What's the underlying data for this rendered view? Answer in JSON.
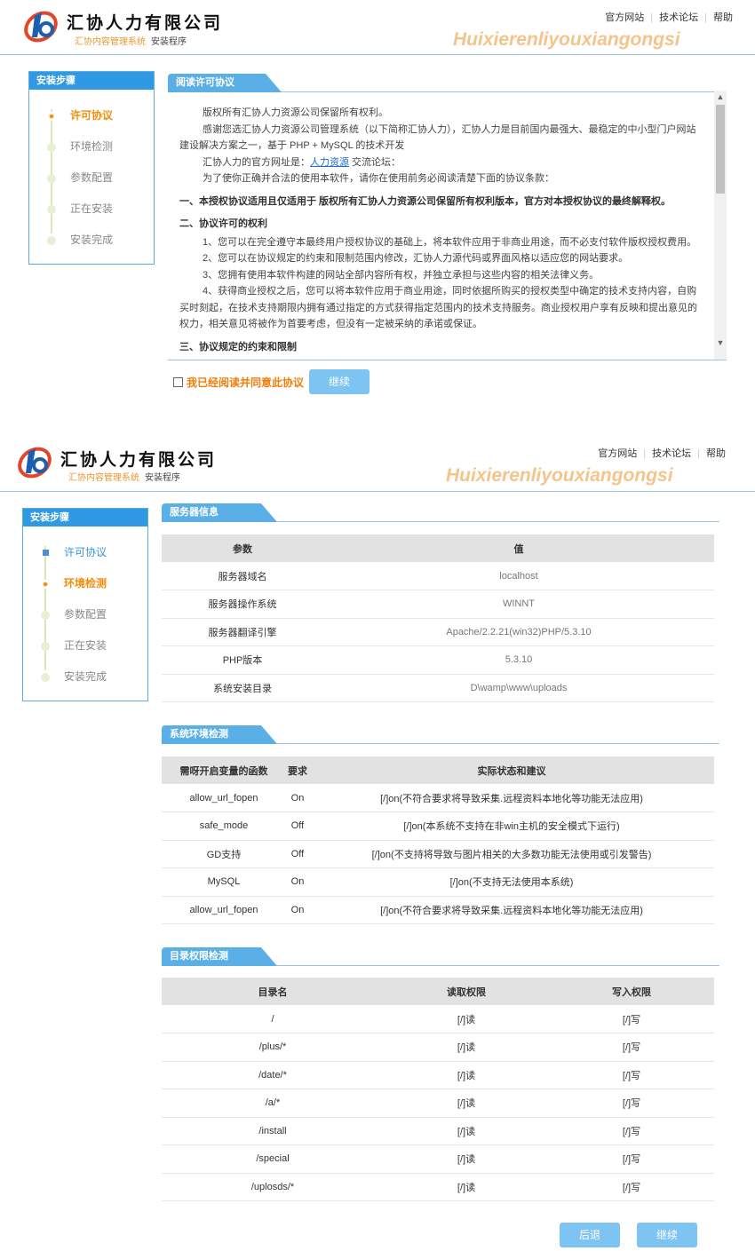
{
  "header": {
    "brand_name": "汇协人力有限公司",
    "brand_system": "汇协内容管理系统",
    "brand_setup": "安装程序",
    "watermark": "Huixierenliyouxiangongsi",
    "nav": [
      "官方网站",
      "技术论坛",
      "帮助"
    ]
  },
  "sidebar": {
    "title": "安装步骤",
    "steps": [
      "许可协议",
      "环境检测",
      "参数配置",
      "正在安装",
      "安装完成"
    ]
  },
  "screen1": {
    "section_title": "阅读许可协议",
    "agreement": {
      "p1": "版权所有汇协人力资源公司保留所有权利。",
      "p2": "感谢您选汇协人力资源公司管理系统（以下简称汇协人力），汇协人力是目前国内最强大、最稳定的中小型门户网站建设解决方案之一，基于 PHP + MySQL 的技术开发",
      "p3_prefix": "汇协人力的官方网址是：",
      "p3_link": "人力资源",
      "p3_suffix": " 交流论坛：",
      "p4": "为了使你正确并合法的使用本软件，请你在使用前务必阅读清楚下面的协议条款：",
      "h1": "一、本授权协议适用且仅适用于 版权所有汇协人力资源公司保留所有权利版本，官方对本授权协议的最终解释权。",
      "h2": "二、协议许可的权利",
      "i1": "1、您可以在完全遵守本最终用户授权协议的基础上，将本软件应用于非商业用途，而不必支付软件版权授权费用。",
      "i2": "2、您可以在协议规定的约束和限制范围内修改，汇协人力源代码或界面风格以适应您的网站要求。",
      "i3": "3、您拥有使用本软件构建的网站全部内容所有权，并独立承担与这些内容的相关法律义务。",
      "i4": "4、获得商业授权之后，您可以将本软件应用于商业用途，同时依据所购买的授权类型中确定的技术支持内容，自购买时刻起，在技术支持期限内拥有通过指定的方式获得指定范围内的技术支持服务。商业授权用户享有反映和提出意见的权力，相关意见将被作为首要考虑，但没有一定被采纳的承诺或保证。",
      "h3": "三、协议规定的约束和限制"
    },
    "agree_label": "我已经阅读并同意此协议",
    "continue_label": "继续"
  },
  "screen2": {
    "server": {
      "title": "服务器信息",
      "headers": [
        "参数",
        "值"
      ],
      "rows": [
        [
          "服务器域名",
          "localhost"
        ],
        [
          "服务器操作系统",
          "WINNT"
        ],
        [
          "服务器翻译引擎",
          "Apache/2.2.21(win32)PHP/5.3.10"
        ],
        [
          "PHP版本",
          "5.3.10"
        ],
        [
          "系统安装目录",
          "D\\wamp\\www\\uploads"
        ]
      ]
    },
    "env": {
      "title": "系统环境检测",
      "headers": [
        "需呀开启变量的函数",
        "要求",
        "实际状态和建议"
      ],
      "rows": [
        [
          "allow_url_fopen",
          "On",
          "[/]on(不符合要求将导致采集.远程资料本地化等功能无法应用)"
        ],
        [
          "safe_mode",
          "Off",
          "[/]on(本系统不支持在非win主机的安全模式下运行)"
        ],
        [
          "GD支持",
          "Off",
          "[/]on(不支持将导致与图片相关的大多数功能无法使用或引发警告)"
        ],
        [
          "MySQL",
          "On",
          "[/]on(不支持无法使用本系统)"
        ],
        [
          "allow_url_fopen",
          "On",
          "[/]on(不符合要求将导致采集.远程资料本地化等功能无法应用)"
        ]
      ]
    },
    "perm": {
      "title": "目录权限检测",
      "headers": [
        "目录名",
        "读取权限",
        "写入权限"
      ],
      "rows": [
        [
          "/",
          "[/]读",
          "[/]写"
        ],
        [
          "/plus/*",
          "[/]读",
          "[/]写"
        ],
        [
          "/date/*",
          "[/]读",
          "[/]写"
        ],
        [
          "/a/*",
          "[/]读",
          "[/]写"
        ],
        [
          "/install",
          "[/]读",
          "[/]写"
        ],
        [
          "/special",
          "[/]读",
          "[/]写"
        ],
        [
          "/uplosds/*",
          "[/]读",
          "[/]写"
        ]
      ]
    },
    "back_label": "后退",
    "continue_label": "继续"
  },
  "colors": {
    "accent_blue": "#2f9ae3",
    "tab_blue": "#5ab0e6",
    "button_blue": "#7ec4f2",
    "active_orange": "#f18d0b",
    "watermark_orange": "#f5c48b"
  }
}
